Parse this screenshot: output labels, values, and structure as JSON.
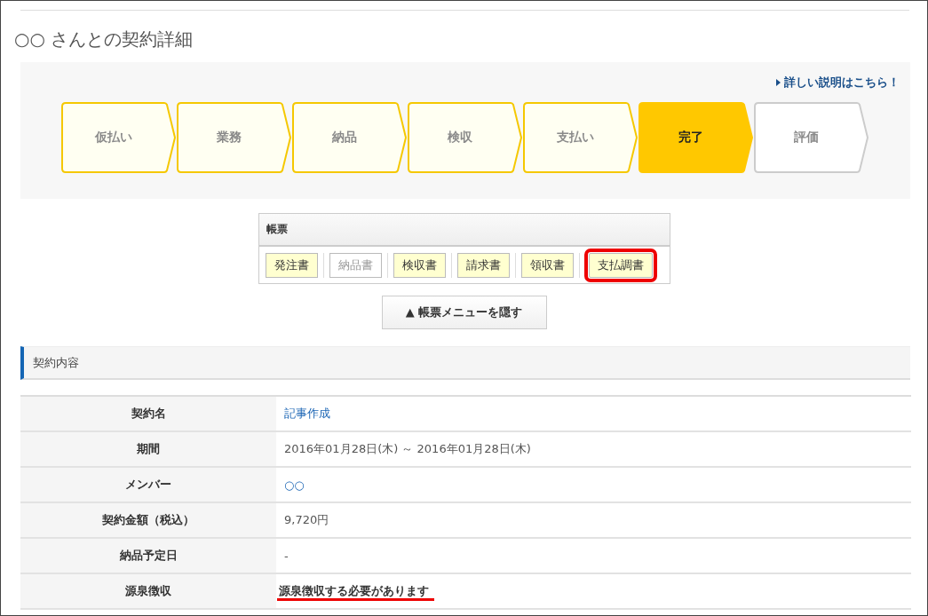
{
  "page_title": "○○ さんとの契約詳細",
  "help_link": "詳しい説明はこちら！",
  "steps": [
    {
      "label": "仮払い",
      "completed": true,
      "selected": false
    },
    {
      "label": "業務",
      "completed": true,
      "selected": false
    },
    {
      "label": "納品",
      "completed": true,
      "selected": false
    },
    {
      "label": "検収",
      "completed": true,
      "selected": false
    },
    {
      "label": "支払い",
      "completed": true,
      "selected": false
    },
    {
      "label": "完了",
      "completed": true,
      "selected": true
    },
    {
      "label": "評価",
      "completed": false,
      "selected": false
    }
  ],
  "documents": {
    "title": "帳票",
    "items": [
      {
        "label": "発注書",
        "disabled": false,
        "highlighted": false
      },
      {
        "label": "納品書",
        "disabled": true,
        "highlighted": false
      },
      {
        "label": "検収書",
        "disabled": false,
        "highlighted": false
      },
      {
        "label": "請求書",
        "disabled": false,
        "highlighted": false
      },
      {
        "label": "領収書",
        "disabled": false,
        "highlighted": false
      },
      {
        "label": "支払調書",
        "disabled": false,
        "highlighted": true
      }
    ]
  },
  "hide_menu_button": "▲ 帳票メニューを隠す",
  "section_title": "契約内容",
  "rows": [
    {
      "label": "契約名",
      "value": "記事作成",
      "kind": "link",
      "underlined": false
    },
    {
      "label": "期間",
      "value": "2016年01月28日(木) ～ 2016年01月28日(木)",
      "kind": "text",
      "underlined": false
    },
    {
      "label": "メンバー",
      "value": "○○",
      "kind": "link",
      "underlined": false
    },
    {
      "label": "契約金額（税込）",
      "value": "9,720円",
      "kind": "text",
      "underlined": false
    },
    {
      "label": "納品予定日",
      "value": "-",
      "kind": "text",
      "underlined": false
    },
    {
      "label": "源泉徴収",
      "value": "源泉徴収する必要があります",
      "kind": "strong",
      "underlined": true
    }
  ]
}
